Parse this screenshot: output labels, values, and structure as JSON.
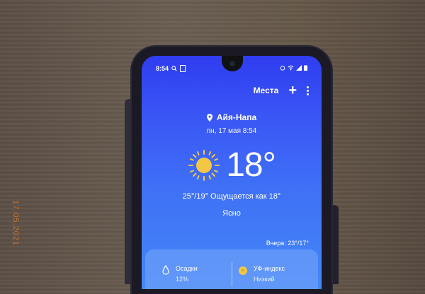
{
  "photo_stamp": "17.05.2021",
  "status_bar": {
    "time": "8:54"
  },
  "app_bar": {
    "places_label": "Места"
  },
  "location": {
    "city": "Айя-Напа"
  },
  "current": {
    "date": "пн, 17 мая 8:54",
    "temperature": "18°",
    "high_low_feels": "25°/19° Ощущается как 18°",
    "condition": "Ясно",
    "yesterday": "Вчера: 23°/17°"
  },
  "details": {
    "precipitation": {
      "label": "Осадки",
      "value": "12%"
    },
    "uv": {
      "label": "УФ-индекс",
      "value": "Низкий"
    }
  },
  "colors": {
    "screen_top": "#2f3df0",
    "screen_bottom": "#4488f7",
    "sun": "#f3c744",
    "date_stamp": "#d8772a"
  },
  "icons": [
    "location-pin-icon",
    "plus-icon",
    "more-vertical-icon",
    "sun-icon",
    "raindrop-icon",
    "uv-index-icon"
  ]
}
